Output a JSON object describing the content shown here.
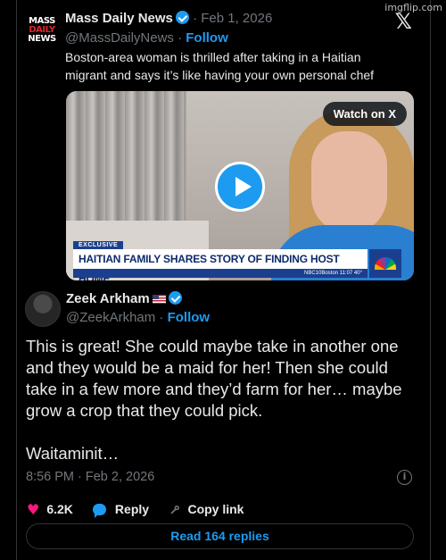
{
  "watermark": "imgflip.com",
  "x_logo": "𝕏",
  "quoted_post": {
    "avatar_lines": [
      "MASS",
      "DAILY",
      "NEWS"
    ],
    "name": "Mass Daily News",
    "date": "· Feb 1, 2026",
    "handle": "@MassDailyNews",
    "follow_label": "Follow",
    "text": "Boston-area woman is thrilled after taking in a Haitian migrant and says it’s like having your own personal chef",
    "media": {
      "watch_label": "Watch on X",
      "banner_tag": "EXCLUSIVE",
      "banner_headline": "HAITIAN FAMILY SHARES STORY OF FINDING HOST HOME",
      "ticker": "NBC10Boston   11:07   40°"
    }
  },
  "post": {
    "name": "Zeek Arkham",
    "handle": "@ZeekArkham",
    "follow_label": "Follow",
    "paragraphs": [
      "This is great! She could maybe take in another one and they would be a maid for her! Then she could take in a few more and they’d farm for her… maybe grow a crop that they could pick.",
      "Waitaminit…"
    ],
    "timestamp": "8:56 PM · Feb 2, 2026",
    "likes": "6.2K",
    "reply_label": "Reply",
    "copy_link_label": "Copy link",
    "read_replies_label": "Read 164 replies"
  },
  "colors": {
    "accent": "#1d9bf0",
    "like": "#f91880",
    "background": "#000000"
  }
}
